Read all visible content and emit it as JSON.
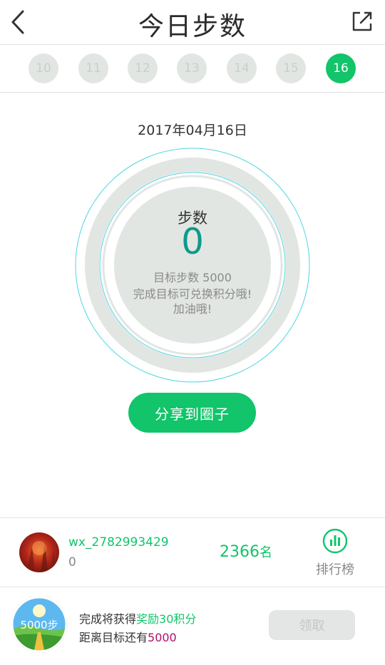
{
  "header": {
    "title": "今日步数",
    "back_icon": "chevron-left-icon",
    "share_icon": "external-share-icon"
  },
  "days": [
    {
      "label": "10",
      "active": false
    },
    {
      "label": "11",
      "active": false
    },
    {
      "label": "12",
      "active": false
    },
    {
      "label": "13",
      "active": false
    },
    {
      "label": "14",
      "active": false
    },
    {
      "label": "15",
      "active": false
    },
    {
      "label": "16",
      "active": true
    }
  ],
  "date": "2017年04月16日",
  "ring": {
    "label": "步数",
    "value": "0",
    "goal_text": "目标步数 5000",
    "line2": "完成目标可兑换积分哦!",
    "line3": "加油哦!",
    "progress": 0
  },
  "share_button": "分享到圈子",
  "user": {
    "name": "wx_2782993429",
    "steps": "0",
    "rank": "2366",
    "rank_unit": "名",
    "leaderboard_label": "排行榜",
    "leaderboard_icon": "bar-chart-icon"
  },
  "reward": {
    "badge_text": "5000步",
    "line1_prefix": "完成将获得",
    "line1_highlight": "奖励30积分",
    "line2_prefix": "距离目标还有",
    "line2_highlight": "5000",
    "claim_label": "领取"
  },
  "colors": {
    "accent": "#12c46a",
    "steps_value": "#0e9a8a",
    "ring_gray": "#e2e6e3",
    "ring_cyan": "#4fd6e0",
    "highlight_purple": "#b0106a"
  }
}
